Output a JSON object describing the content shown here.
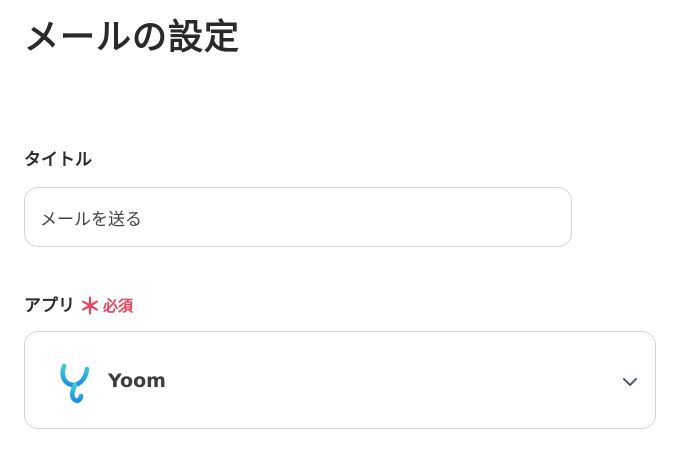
{
  "page": {
    "title": "メールの設定"
  },
  "form": {
    "title_field": {
      "label": "タイトル",
      "value": "メールを送る"
    },
    "app_field": {
      "label": "アプリ",
      "required_mark": "＊",
      "required_text": "必須",
      "selected_app": "Yoom",
      "app_icon": "yoom-logo-icon",
      "dropdown_icon": "chevron-down-icon"
    }
  },
  "colors": {
    "required": "#e8425a",
    "border": "#d2d6dc",
    "logo_teal": "#35c9d6",
    "logo_blue": "#1f8fe0"
  }
}
